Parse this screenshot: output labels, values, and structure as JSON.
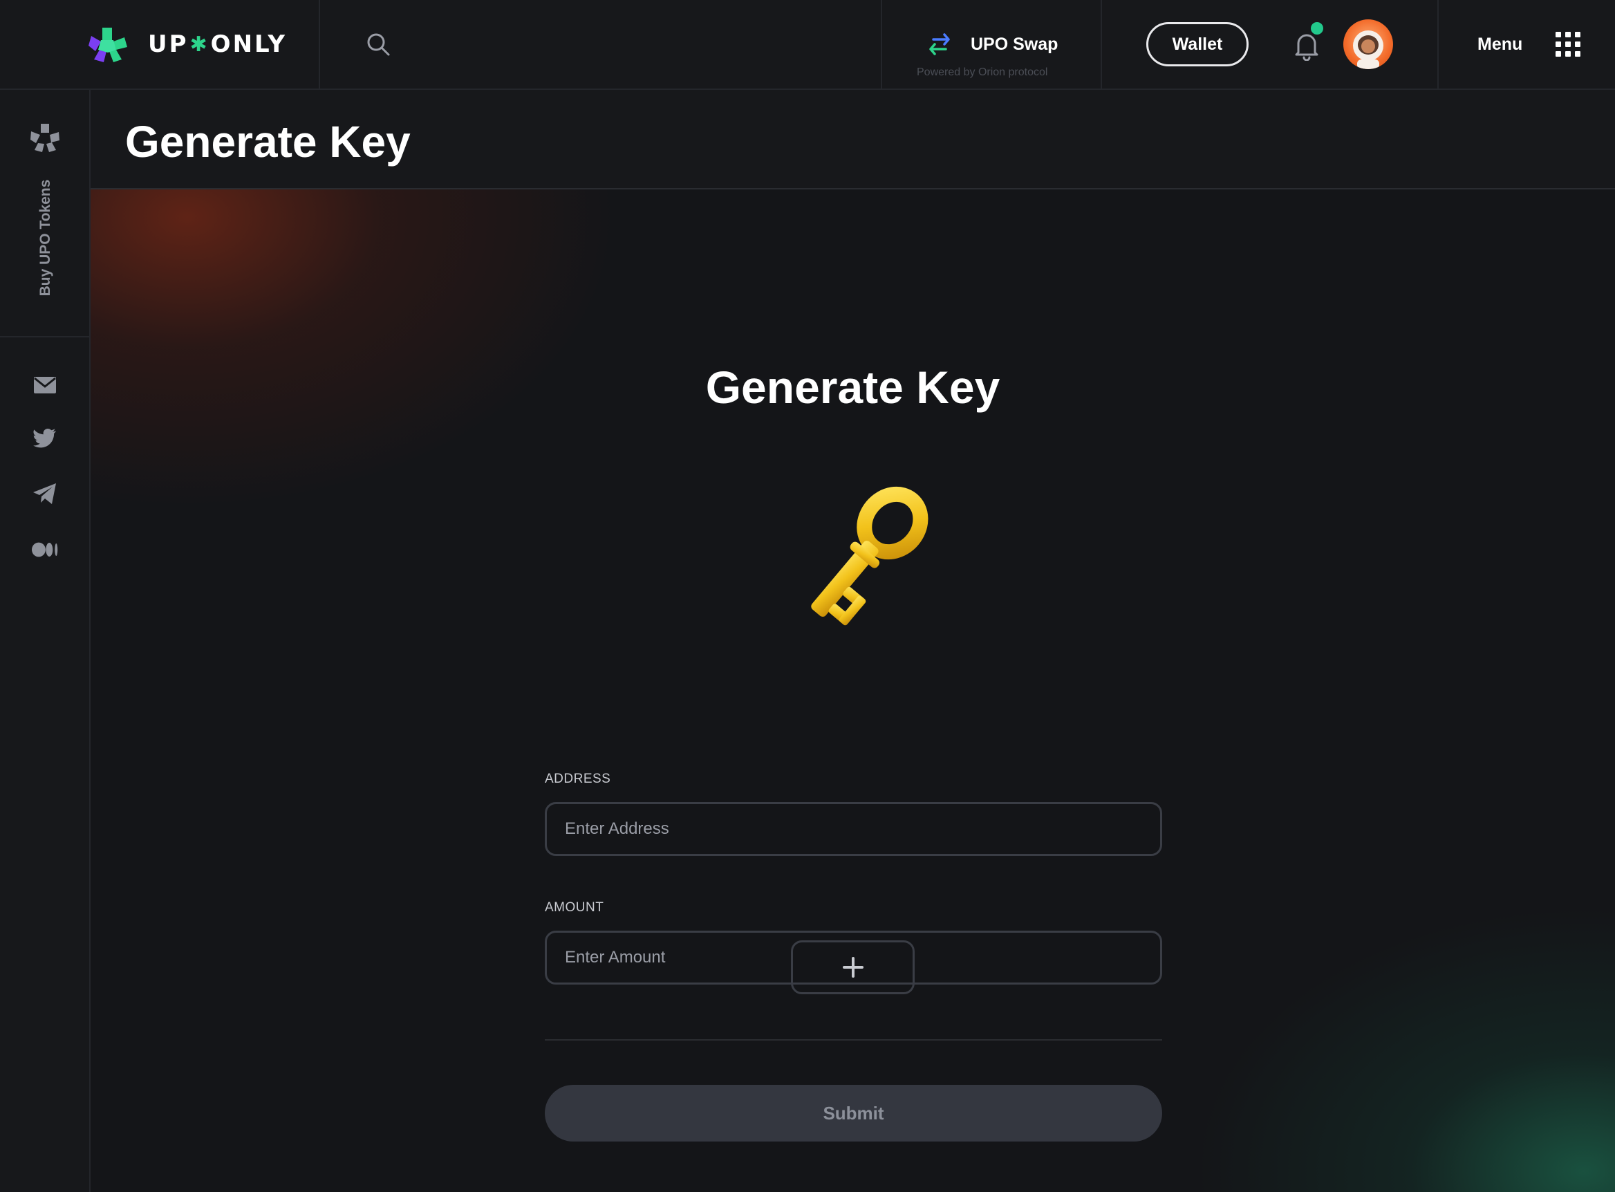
{
  "header": {
    "logo_text_left": "UP",
    "logo_text_star": "✱",
    "logo_text_right": "ONLY",
    "swap_title": "UPO Swap",
    "swap_subtitle": "Powered by Orion protocol",
    "wallet_label": "Wallet",
    "menu_label": "Menu",
    "notification_unread": true
  },
  "sidebar": {
    "buy_label": "Buy UPO Tokens",
    "social_icons": [
      "mail-icon",
      "twitter-icon",
      "telegram-icon",
      "medium-icon"
    ]
  },
  "page": {
    "title": "Generate Key"
  },
  "form": {
    "title": "Generate Key",
    "address_label": "ADDRESS",
    "address_placeholder": "Enter Address",
    "address_value": "",
    "amount_label": "AMOUNT",
    "amount_placeholder": "Enter Amount",
    "amount_value": "",
    "add_button_symbol": "+",
    "submit_label": "Submit"
  },
  "colors": {
    "accent_green": "#22c98c",
    "logo_purple": "#7b3ff2",
    "key_gold": "#f2c21b",
    "avatar_orange": "#f36b2a"
  }
}
